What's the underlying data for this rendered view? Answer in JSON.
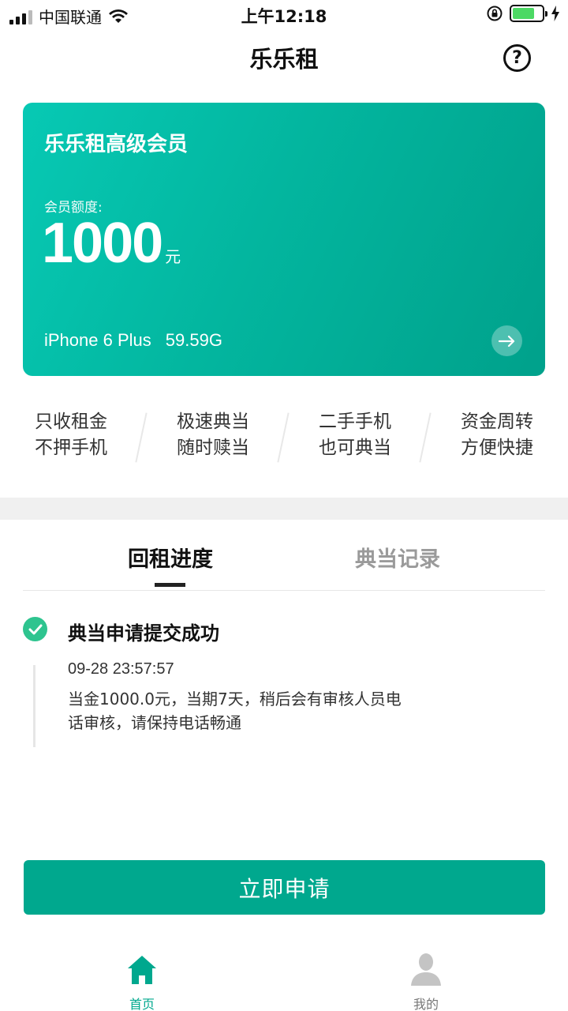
{
  "status_bar": {
    "carrier": "中国联通",
    "time": "上午12:18",
    "battery_level": 0.75,
    "battery_color": "#4cd964"
  },
  "nav": {
    "title": "乐乐租",
    "help_icon": "question-circle-icon",
    "help_glyph": "?"
  },
  "card": {
    "title": "乐乐租高级会员",
    "quota_label": "会员额度:",
    "quota_value": "1000",
    "quota_unit": "元",
    "device_model": "iPhone 6 Plus",
    "device_storage": "59.59G",
    "arrow_icon": "arrow-right-icon",
    "gradient_start": "#07c9b4",
    "gradient_end": "#00a18b"
  },
  "features": [
    {
      "line1": "只收租金",
      "line2": "不押手机"
    },
    {
      "line1": "极速典当",
      "line2": "随时赎当"
    },
    {
      "line1": "二手手机",
      "line2": "也可典当"
    },
    {
      "line1": "资金周转",
      "line2": "方便快捷"
    }
  ],
  "tabs": [
    {
      "label": "回租进度",
      "active": true
    },
    {
      "label": "典当记录",
      "active": false
    }
  ],
  "timeline": {
    "status_icon": "check-circle-icon",
    "status_color": "#2ec48f",
    "title": "典当申请提交成功",
    "time": "09-28 23:57:57",
    "description": "当金1000.0元，当期7天，稍后会有审核人员电话审核，请保持电话畅通"
  },
  "apply_button": {
    "label": "立即申请",
    "color": "#00a88e"
  },
  "bottom_nav": [
    {
      "label": "首页",
      "icon": "home-icon",
      "active": true
    },
    {
      "label": "我的",
      "icon": "user-icon",
      "active": false
    }
  ]
}
